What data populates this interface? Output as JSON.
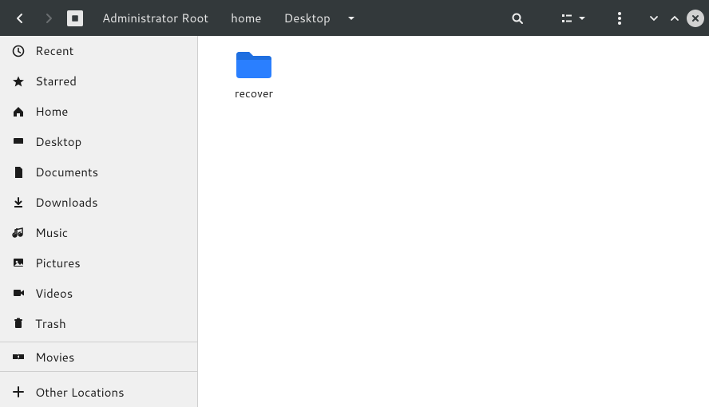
{
  "path": {
    "root_label": "Administrator Root",
    "segments": [
      "home",
      "Desktop"
    ]
  },
  "sidebar": {
    "items": [
      {
        "label": "Recent"
      },
      {
        "label": "Starred"
      },
      {
        "label": "Home"
      },
      {
        "label": "Desktop"
      },
      {
        "label": "Documents"
      },
      {
        "label": "Downloads"
      },
      {
        "label": "Music"
      },
      {
        "label": "Pictures"
      },
      {
        "label": "Videos"
      },
      {
        "label": "Trash"
      }
    ],
    "mount": {
      "label": "Movies"
    },
    "other": {
      "label": "Other Locations"
    }
  },
  "content": {
    "items": [
      {
        "name": "recover",
        "type": "folder"
      }
    ]
  },
  "colors": {
    "folder_blue": "#2a7fff"
  }
}
